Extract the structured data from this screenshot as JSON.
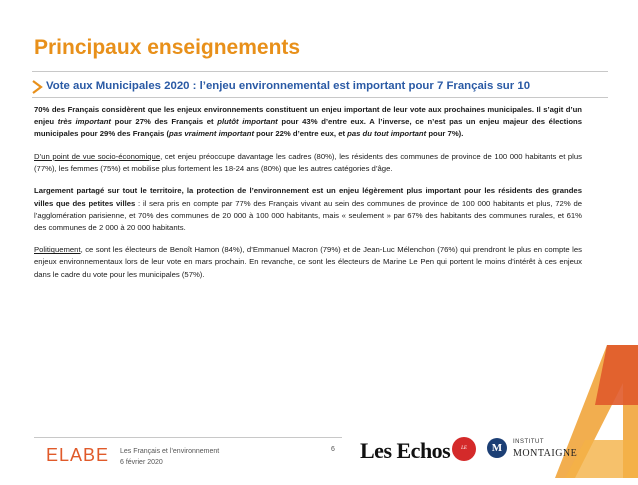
{
  "header": {
    "title": "Principaux enseignements",
    "subtitle": "Vote aux Municipales 2020 : l’enjeu environnemental est important pour 7 Français sur 10"
  },
  "p1": {
    "a": "70% des Français considèrent que les enjeux environnements constituent un enjeu important de leur vote aux prochaines municipales. Il s’agit d’un enjeu ",
    "b": "très important",
    "c": " pour 27% des Français et ",
    "d": "plutôt important",
    "e": " pour 43% d’entre eux. A l’inverse, ce n’est pas un enjeu majeur des élections municipales pour 29% des Français (",
    "f": "pas vraiment important",
    "g": " pour 22% d’entre eux, et ",
    "h": "pas du tout important",
    "i": " pour 7%)."
  },
  "p2": {
    "a": "D’un point de vue socio-économique",
    "b": ", cet enjeu préoccupe davantage les cadres (80%), les résidents des communes de province de 100 000 habitants et plus (77%), les femmes (75%) et mobilise plus fortement les 18-24 ans (80%) que les autres catégories d’âge."
  },
  "p3": {
    "a": "Largement partagé sur tout le territoire, la protection de l’environnement est un enjeu légèrement plus important pour les résidents des grandes villes que des petites villes",
    "b": " : il sera pris en compte par 77% des Français vivant au sein des communes de province de 100 000 habitants et plus, 72% de l’agglomération parisienne, et 70% des communes de 20 000 à 100 000 habitants, mais « seulement » par 67% des habitants des communes rurales, et 61% des communes de 2 000 à 20 000 habitants."
  },
  "p4": {
    "a": "Politiquement",
    "b": ", ce sont les électeurs de Benoît Hamon (84%), d’Emmanuel Macron (79%) et de Jean-Luc Mélenchon (76%) qui prendront le plus en compte les enjeux environnementaux lors de leur vote en mars prochain. En revanche, ce sont les électeurs de Marine Le Pen qui portent le moins d’intérêt à ces enjeux dans le cadre du vote pour les municipales (57%)."
  },
  "footer": {
    "brand": "ELABE",
    "line1": "Les Français et l’environnement",
    "line2": "6 février 2020",
    "page": "6",
    "partner1": "Les Echos",
    "partner2": "LE PARISIEN",
    "partner3_letter": "M",
    "partner3_small": "INSTITUT",
    "partner3_big": "MONTAIGNE"
  },
  "colors": {
    "title": "#e8901a",
    "subtitle": "#2a5aa5",
    "brand": "#e05a2a"
  }
}
